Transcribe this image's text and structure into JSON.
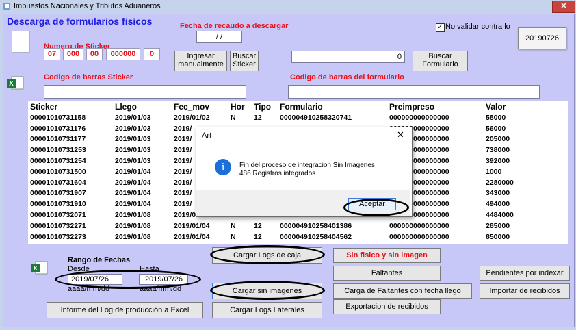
{
  "window": {
    "title": "Impuestos Nacionales y Tributos Aduaneros",
    "close": "✕"
  },
  "header": {
    "title": "Descarga de formularios fisicos"
  },
  "fecha_recaudo": {
    "label": "Fecha de recaudo a descargar",
    "value": " / /"
  },
  "no_validar": {
    "label": "No validar contra lo",
    "checked": true
  },
  "date_box": "20190726",
  "sticker": {
    "label": "Numero de Sticker",
    "segments": [
      "07",
      "000",
      "00",
      "000000",
      "0"
    ],
    "ingresar": "Ingresar manualmente",
    "buscar": "Buscar Sticker"
  },
  "formulario": {
    "value": "0",
    "buscar": "Buscar Formulario"
  },
  "codigo_sticker_label": "Codigo de barras Sticker",
  "codigo_formulario_label": "Codigo de barras del formulario",
  "grid": {
    "columns": [
      "Sticker",
      "Llego",
      "Fec_mov",
      "Hor",
      "Tipo",
      "Formulario",
      "Preimpreso",
      "Valor"
    ],
    "rows": [
      [
        "00001010731158",
        "2019/01/03",
        "2019/01/02",
        "N",
        "12",
        "000004910258320741",
        "000000000000000",
        "58000"
      ],
      [
        "00001010731176",
        "2019/01/03",
        "2019/",
        "",
        "",
        "",
        "000000000000000",
        "56000"
      ],
      [
        "00001010731177",
        "2019/01/03",
        "2019/",
        "",
        "",
        "",
        "000000000000000",
        "205000"
      ],
      [
        "00001010731253",
        "2019/01/03",
        "2019/",
        "",
        "",
        "",
        "000000000000000",
        "738000"
      ],
      [
        "00001010731254",
        "2019/01/03",
        "2019/",
        "",
        "",
        "",
        "000000000000000",
        "392000"
      ],
      [
        "00001010731500",
        "2019/01/04",
        "2019/",
        "",
        "",
        "",
        "000000000000000",
        "1000"
      ],
      [
        "00001010731604",
        "2019/01/04",
        "2019/",
        "",
        "",
        "",
        "000000000000000",
        "2280000"
      ],
      [
        "00001010731907",
        "2019/01/04",
        "2019/",
        "",
        "",
        "",
        "000000000000000",
        "343000"
      ],
      [
        "00001010731910",
        "2019/01/04",
        "2019/",
        "",
        "",
        "",
        "000000000000000",
        "494000"
      ],
      [
        "00001010732071",
        "2019/01/08",
        "2019/01/04",
        "N",
        "12",
        "000004910258429033",
        "000000000000000",
        "4484000"
      ],
      [
        "00001010732271",
        "2019/01/08",
        "2019/01/04",
        "N",
        "12",
        "000004910258401386",
        "000000000000000",
        "285000"
      ],
      [
        "00001010732273",
        "2019/01/08",
        "2019/01/04",
        "N",
        "12",
        "000004910258404562",
        "000000000000000",
        "850000"
      ]
    ]
  },
  "rango": {
    "title": "Rango de Fechas",
    "desde_label": "Desde",
    "hasta_label": "Hasta",
    "desde": "2019/07/26",
    "hasta": "2019/07/26",
    "fmt1": "aaaa/mm/dd",
    "fmt2": "aaaa/mm/dd"
  },
  "buttons": {
    "cargar_logs_caja": "Cargar Logs de caja",
    "cargar_sin_imagenes": "Cargar sin imagenes",
    "cargar_logs_laterales": "Cargar Logs Laterales",
    "informe": "Informe del Log de producción a Excel",
    "sin_fisico": "Sin fisico y sin imagen",
    "faltantes": "Faltantes",
    "carga_faltantes": "Carga de Faltantes con fecha llego",
    "exportacion": "Exportacion de recibidos",
    "pendientes": "Pendientes por indexar",
    "importar": "Importar de recibidos"
  },
  "dialog": {
    "title": "Art",
    "close": "✕",
    "line1": "Fin del proceso de integracion Sin Imagenes",
    "line2": "486 Registros integrados",
    "ok": "Aceptar",
    "icon": "i"
  }
}
